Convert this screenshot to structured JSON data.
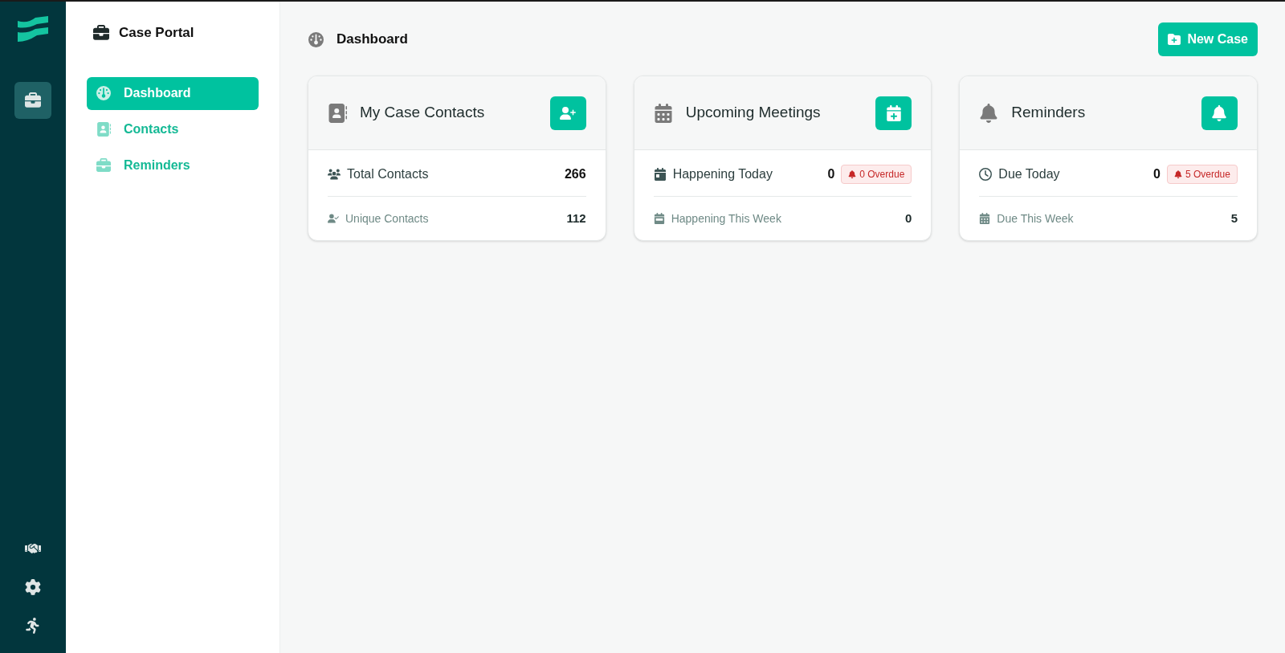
{
  "app": {
    "title": "Case Portal"
  },
  "rail": {
    "items": [
      {
        "selected": true
      }
    ]
  },
  "nav": [
    {
      "label": "Dashboard",
      "kind": "dashboard",
      "selected": true
    },
    {
      "label": "Contacts",
      "kind": "contacts",
      "selected": false
    },
    {
      "label": "Reminders",
      "kind": "reminders",
      "selected": false
    }
  ],
  "page": {
    "title": "Dashboard",
    "new_button": "New Case"
  },
  "cards": [
    {
      "kind": "contacts",
      "title": "My Case Contacts",
      "rows": [
        {
          "kind": "primary",
          "label": "Total Contacts",
          "value": "266"
        },
        {
          "kind": "secondary",
          "label": "Unique Contacts",
          "value": "112"
        }
      ]
    },
    {
      "kind": "meetings",
      "title": "Upcoming Meetings",
      "rows": [
        {
          "kind": "primary",
          "label": "Happening Today",
          "value": "0",
          "badge": "0 Overdue"
        },
        {
          "kind": "secondary",
          "label": "Happening This Week",
          "value": "0"
        }
      ]
    },
    {
      "kind": "reminders",
      "title": "Reminders",
      "rows": [
        {
          "kind": "primary",
          "label": "Due Today",
          "value": "0",
          "badge": "5 Overdue"
        },
        {
          "kind": "secondary",
          "label": "Due This Week",
          "value": "5"
        }
      ]
    }
  ]
}
